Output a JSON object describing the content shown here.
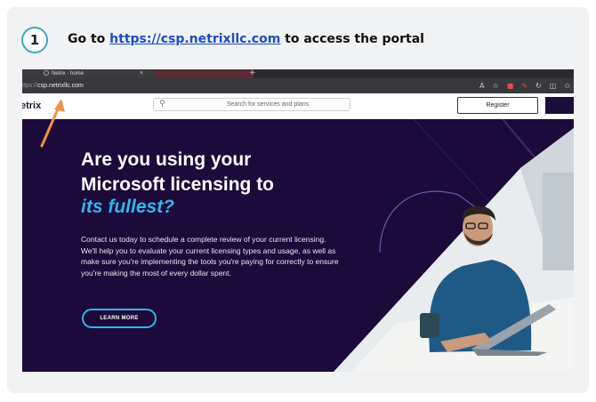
{
  "step": {
    "number": "1",
    "text_prefix": "Go to ",
    "link_text": "https://csp.netrixllc.com",
    "text_suffix": " to access the portal"
  },
  "browser": {
    "tab_title": "Netrix - home",
    "tab_close": "×",
    "new_tab": "+",
    "url_prefix": "ttps://",
    "url_host": "csp.netrixllc.com"
  },
  "site_header": {
    "logo": "etrix",
    "search_placeholder": "Search for services and plans",
    "register_label": "Register"
  },
  "hero": {
    "headline_line1": "Are you using your",
    "headline_line2": "Microsoft licensing to",
    "headline_line3": "its fullest?",
    "body": "Contact us today to schedule a complete review of your current licensing. We'll help you to evaluate your current licensing types and usage, as well as make sure you're implementing the tools you're paying for correctly to ensure you're making the most of every dollar spent.",
    "cta_label": "LEARN MORE"
  },
  "colors": {
    "accent": "#2fb6ec",
    "hero_bg": "#1b0a3a",
    "step_ring": "#3aa7bf",
    "link": "#1a4fc4",
    "arrow": "#f0924a"
  },
  "icons": {
    "step_badge": "circle-number",
    "search": "search-icon",
    "annotation": "arrow-icon"
  }
}
